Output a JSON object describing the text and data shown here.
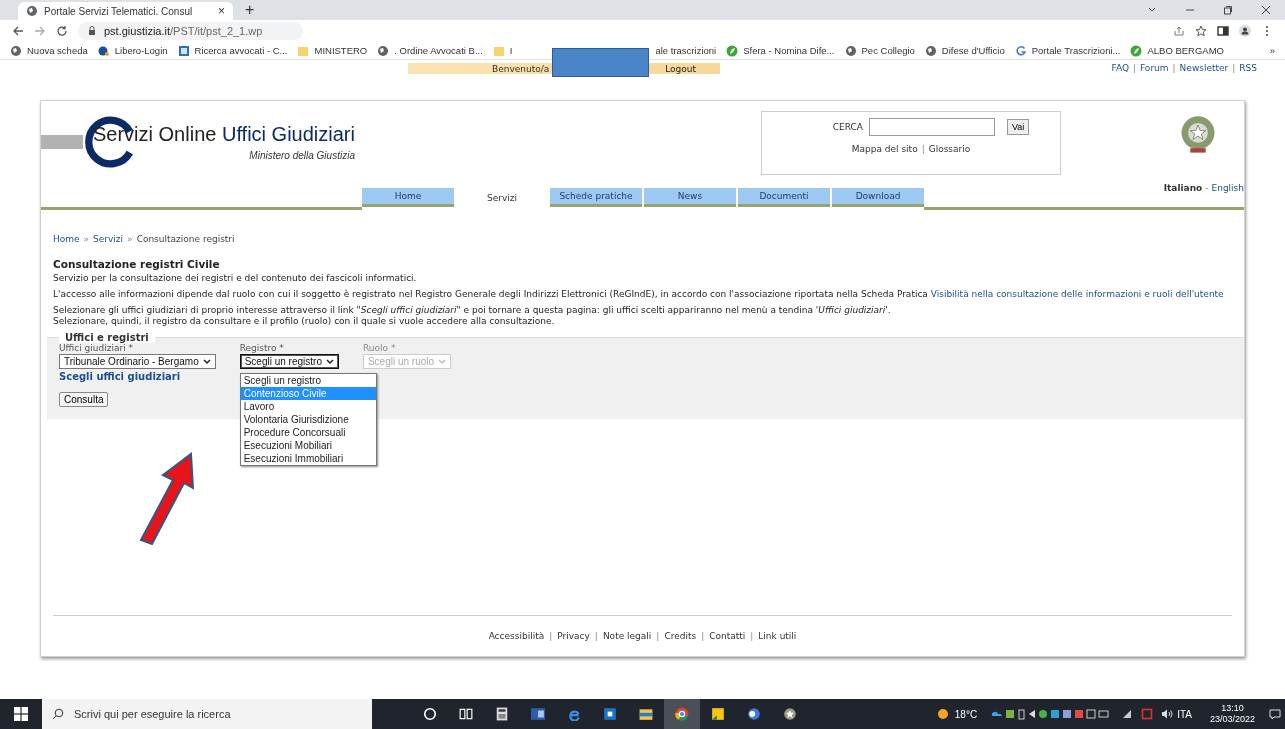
{
  "browser": {
    "tab_title": "Portale Servizi Telematici. Consul",
    "tab_close": "×",
    "new_tab": "+",
    "url_host": "pst.giustizia.it",
    "url_path": "/PST/it/pst_2_1.wp",
    "bookmarks": [
      {
        "label": "Nuova scheda",
        "kind": "globe"
      },
      {
        "label": "Libero-Login",
        "kind": "libero"
      },
      {
        "label": "Ricerca avvocati - C...",
        "kind": "box"
      },
      {
        "label": "MINISTERO",
        "kind": "folder"
      },
      {
        "label": ". Ordine Avvocati B...",
        "kind": "globe"
      },
      {
        "label": "I",
        "kind": "folder"
      },
      {
        "label": "ale trascrizioni",
        "kind": "none"
      },
      {
        "label": "Sfera - Nomina Dife...",
        "kind": "sfera"
      },
      {
        "label": "Pec Collegio",
        "kind": "globe"
      },
      {
        "label": "Difese d'Ufficio",
        "kind": "globe"
      },
      {
        "label": "Portale Trascrizioni...",
        "kind": "g"
      },
      {
        "label": "ALBO BERGAMO",
        "kind": "sfera"
      }
    ],
    "more": "»"
  },
  "site": {
    "welcome": "Benvenuto/a",
    "logout": "Logout",
    "separator": "|",
    "top_links": [
      "FAQ",
      "Forum",
      "Newsletter",
      "RSS"
    ],
    "logo_title": "Servizi Online",
    "logo_accent": "Uffici Giudiziari",
    "logo_subtitle": "Ministero della Giustizia",
    "search_label": "CERCA",
    "search_button": "Vai",
    "search_links": [
      "Mappa del sito",
      "Glossario"
    ],
    "languages": [
      {
        "label": "Italiano",
        "selected": true
      },
      {
        "label": "English",
        "selected": false
      }
    ],
    "language_separator": "-",
    "nav": [
      {
        "label": "Home",
        "selected": false
      },
      {
        "label": "Servizi",
        "selected": true
      },
      {
        "label": "Schede pratiche",
        "selected": false
      },
      {
        "label": "News",
        "selected": false
      },
      {
        "label": "Documenti",
        "selected": false
      },
      {
        "label": "Download",
        "selected": false
      }
    ]
  },
  "breadcrumb": {
    "items": [
      "Home",
      "Servizi",
      "Consultazione registri"
    ],
    "separator": "»"
  },
  "heading": "Consultazione registri Civile",
  "intro": "Servizio per la consultazione dei registri e del contenuto dei fascicoli informatici.",
  "access_text": "L'accesso alle informazioni dipende dal ruolo con cui il soggetto è registrato nel Registro Generale degli Indirizzi Elettronici (ReGIndE), in accordo con l'associazione riportata nella Scheda Pratica",
  "access_link": "Visibilità nella consultazione delle informazioni e ruoli dell'utente",
  "instructions": [
    "Selezionare gli uffici giudiziari di proprio interesse attraverso il link \"*Scegli uffici giudiziari*\" e poi tornare a questa pagina: gli uffici scelti appariranno nel menù a tendina '*Uffici giudiziari*'.",
    "Selezionare, quindi, il registro da consultare e il profilo (ruolo) con il quale si vuole accedere alla consultazione."
  ],
  "form": {
    "legend": "Uffici e registri",
    "fields": [
      {
        "label": "Uffici giudiziari *",
        "value": "Tribunale Ordinario - Bergamo",
        "disabled": false,
        "expanded": false
      },
      {
        "label": "Registro *",
        "value": "Scegli un registro",
        "disabled": false,
        "expanded": true
      },
      {
        "label": "Ruolo *",
        "value": "Scegli un ruolo",
        "disabled": true,
        "expanded": false
      }
    ],
    "link": "Scegli uffici giudiziari",
    "button": "Consulta",
    "options": [
      {
        "label": "Scegli un registro",
        "selected": false
      },
      {
        "label": "Contenzioso Civile",
        "selected": true
      },
      {
        "label": "Lavoro",
        "selected": false
      },
      {
        "label": "Volontaria Giurisdizione",
        "selected": false
      },
      {
        "label": "Procedure Concorsuali",
        "selected": false
      },
      {
        "label": "Esecuzioni Mobiliari",
        "selected": false
      },
      {
        "label": "Esecuzioni Immobiliari",
        "selected": false
      }
    ]
  },
  "footer": {
    "links": [
      "Accessibilità",
      "Privacy",
      "Note legali",
      "Credits",
      "Contatti",
      "Link utili"
    ],
    "separator": "|"
  },
  "taskbar": {
    "search_placeholder": "Scrivi qui per eseguire la ricerca",
    "temperature": "18°C",
    "language": "ITA",
    "time": "13:10",
    "date": "23/03/2022"
  }
}
